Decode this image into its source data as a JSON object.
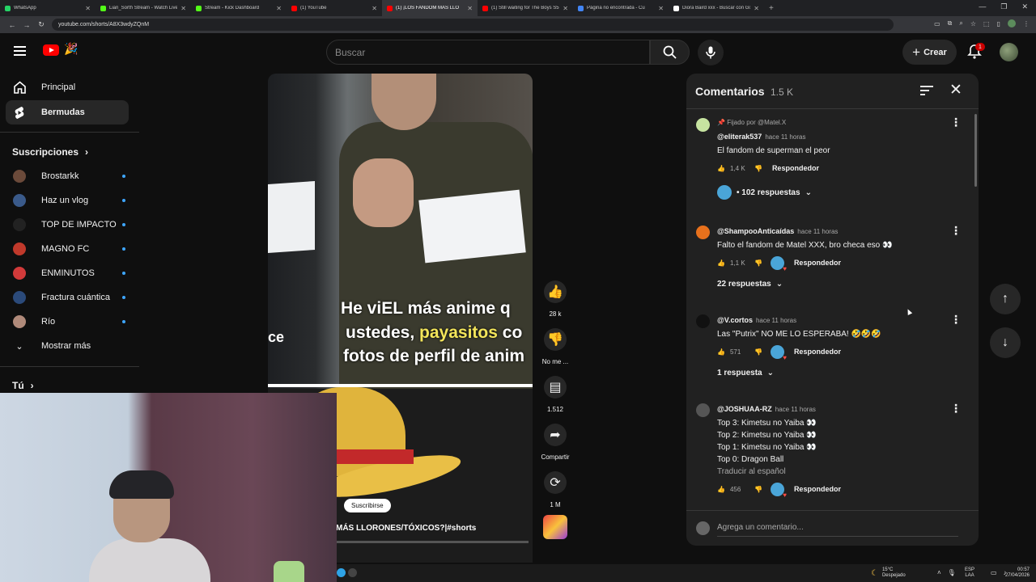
{
  "browser": {
    "tabs": [
      {
        "title": "WhatsApp",
        "color": "#25d366",
        "active": false
      },
      {
        "title": "Lian_Sorth Stream - Watch Live",
        "color": "#53fc18",
        "active": false
      },
      {
        "title": "Stream - Kick Dashboard",
        "color": "#53fc18",
        "active": false
      },
      {
        "title": "(1) YouTube",
        "color": "#ff0000",
        "active": false
      },
      {
        "title": "(1) ¡LOS FANDOM MAS LLO",
        "color": "#ff0000",
        "active": true
      },
      {
        "title": "(1) Still waiting for The Boys S5",
        "color": "#ff0000",
        "active": false
      },
      {
        "title": "Página no encontrada - Cu",
        "color": "#4285f4",
        "active": false
      },
      {
        "title": "Diora Baird xxx - Buscar con Go",
        "color": "#ffffff",
        "active": false
      }
    ],
    "new_tab": "+",
    "url": "youtube.com/shorts/A8X3wdyZQnM"
  },
  "header": {
    "search_placeholder": "Buscar",
    "create_label": "Crear",
    "notif_count": "1"
  },
  "sidebar": {
    "main": [
      {
        "label": "Principal",
        "icon": "home-icon",
        "selected": false
      },
      {
        "label": "Bermudas",
        "icon": "shorts-icon",
        "selected": true
      }
    ],
    "subs_heading": "Suscripciones",
    "subs": [
      {
        "label": "Brostarkk",
        "color": "#6b4a3a"
      },
      {
        "label": "Haz un vlog",
        "color": "#3a5a8a"
      },
      {
        "label": "TOP DE IMPACTO",
        "color": "#222222"
      },
      {
        "label": "MAGNO FC",
        "color": "#c0392b"
      },
      {
        "label": "ENMINUTOS",
        "color": "#d23a3a"
      },
      {
        "label": "Fractura cuántica",
        "color": "#2b4a7a"
      },
      {
        "label": "Río",
        "color": "#b08a7a"
      }
    ],
    "more_label": "Mostrar más",
    "you_heading": "Tú"
  },
  "video": {
    "caption_l1": "He viEL más anime q",
    "caption_l2a": "ustedes, ",
    "caption_l2b": "payasitos",
    "caption_l2c": " co",
    "caption_l3": "fotos de perfil de anim",
    "caption_left": "ce",
    "subscribe": "Suscribirse",
    "title": "MÁS LLORONES/TÓXICOS?|#shorts"
  },
  "actions": {
    "likes": "28 k",
    "dislike": "No me ...",
    "comments": "1.512",
    "share": "Compartir",
    "remix": "1 M"
  },
  "comments_panel": {
    "title": "Comentarios",
    "count": "1.5 K",
    "add_placeholder": "Agrega un comentario...",
    "items": [
      {
        "pinned": "Fijado por @Matel.X",
        "user": "@eliterak537",
        "when": "hace 11 horas",
        "lines": [
          "El fandom de superman el peor"
        ],
        "likes": "1,4 K",
        "creator_heart": false,
        "reply": "Respondedor",
        "replies": "• 102 respuestas",
        "avatar": "#c6e3a0"
      },
      {
        "pinned": "",
        "user": "@ShampooAnticaídas",
        "when": "hace 11 horas",
        "lines": [
          "Falto el fandom de Matel XXX, bro checa eso 👀"
        ],
        "likes": "1,1 K",
        "creator_heart": true,
        "reply": "Respondedor",
        "replies": "22 respuestas",
        "avatar": "#e8711c"
      },
      {
        "pinned": "",
        "user": "@V.cortos",
        "when": "hace 11 horas",
        "lines": [
          "Las \"Putrix\" NO ME LO ESPERABA! 🤣🤣🤣"
        ],
        "likes": "571",
        "creator_heart": true,
        "reply": "Respondedor",
        "replies": "1 respuesta",
        "avatar": "#111111"
      },
      {
        "pinned": "",
        "user": "@JOSHUAA-RZ",
        "when": "hace 11 horas",
        "lines": [
          "Top 3: Kimetsu no Yaiba 👀",
          "Top 2: Kimetsu no Yaiba 👀",
          "Top 1: Kimetsu no Yaiba 👀",
          "Top 0: Dragon Ball"
        ],
        "translate": "Traducir al español",
        "likes": "456",
        "creator_heart": true,
        "reply": "Respondedor",
        "replies": "",
        "avatar": "#555555"
      }
    ]
  },
  "taskbar": {
    "temp": "15°C",
    "weather": "Despejado",
    "lang1": "ESP",
    "lang2": "LAA",
    "time": "00:57",
    "date": "27/04/2026"
  }
}
